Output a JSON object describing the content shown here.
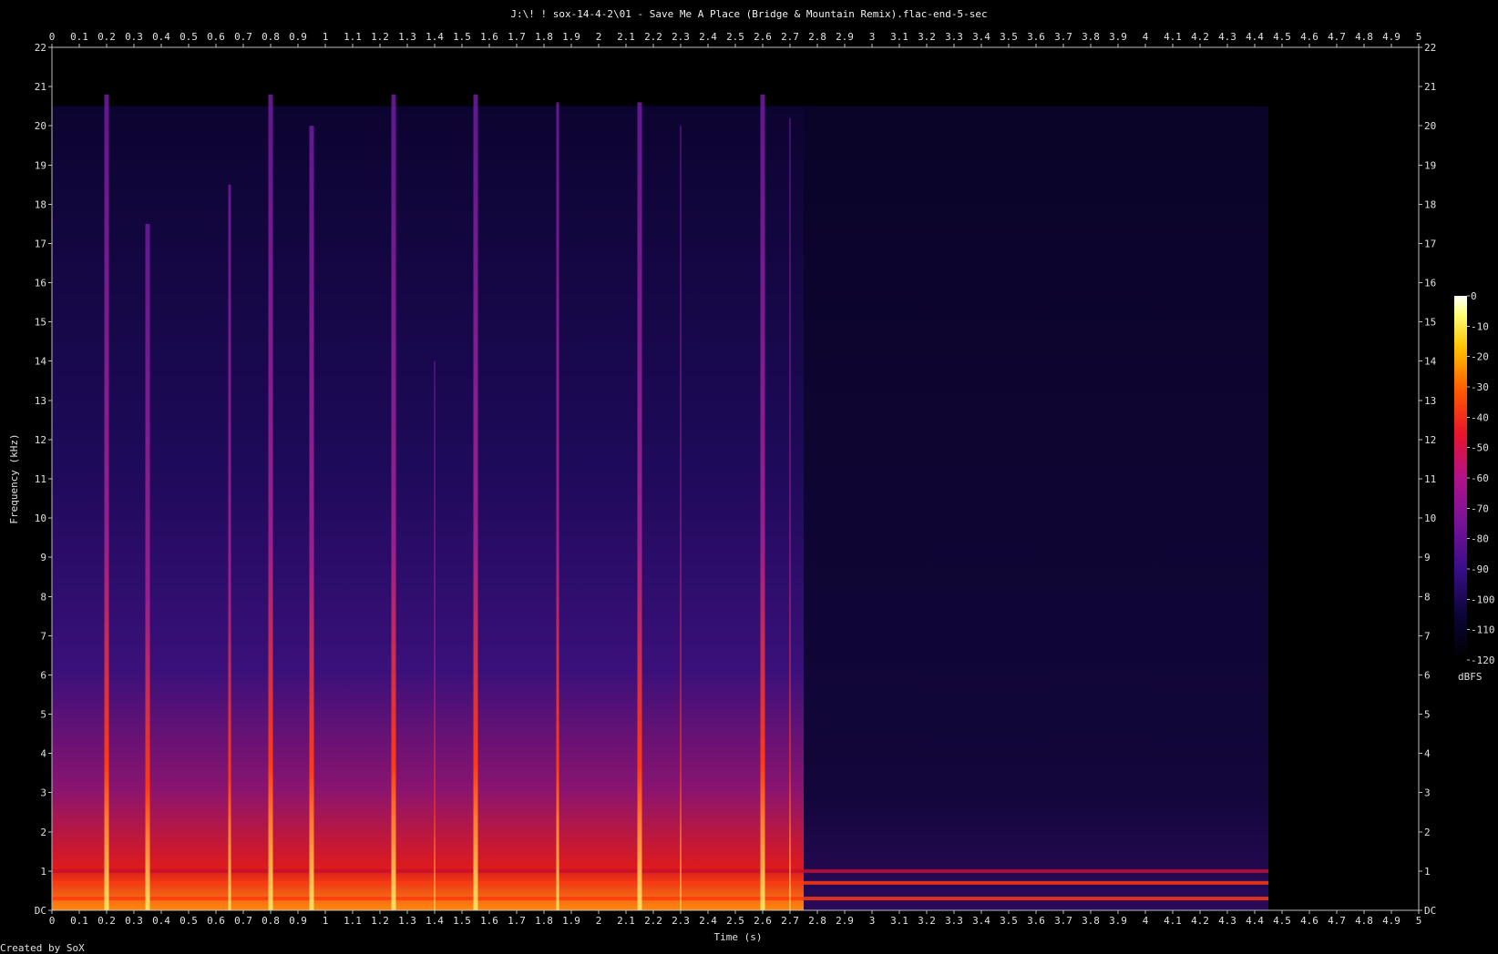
{
  "chart_data": {
    "type": "heatmap",
    "title": "J:\\! ! sox-14-4-2\\01 - Save Me A Place (Bridge & Mountain Remix).flac-end-5-sec",
    "xlabel": "Time (s)",
    "ylabel": "Frequency (kHz)",
    "footer": "Created by SoX",
    "xlim": [
      0,
      5
    ],
    "ylim": [
      0,
      22
    ],
    "x_ticks": [
      "0",
      "0.1",
      "0.2",
      "0.3",
      "0.4",
      "0.5",
      "0.6",
      "0.7",
      "0.8",
      "0.9",
      "1",
      "1.1",
      "1.2",
      "1.3",
      "1.4",
      "1.5",
      "1.6",
      "1.7",
      "1.8",
      "1.9",
      "2",
      "2.1",
      "2.2",
      "2.3",
      "2.4",
      "2.5",
      "2.6",
      "2.7",
      "2.8",
      "2.9",
      "3",
      "3.1",
      "3.2",
      "3.3",
      "3.4",
      "3.5",
      "3.6",
      "3.7",
      "3.8",
      "3.9",
      "4",
      "4.1",
      "4.2",
      "4.3",
      "4.4",
      "4.5",
      "4.6",
      "4.7",
      "4.8",
      "4.9",
      "5"
    ],
    "y_ticks": [
      "DC",
      "1",
      "2",
      "3",
      "4",
      "5",
      "6",
      "7",
      "8",
      "9",
      "10",
      "11",
      "12",
      "13",
      "14",
      "15",
      "16",
      "17",
      "18",
      "19",
      "20",
      "21",
      "22"
    ],
    "colorbar": {
      "label": "dBFS",
      "range": [
        -120,
        0
      ],
      "ticks": [
        "0",
        "-10",
        "-20",
        "-30",
        "-40",
        "-50",
        "-60",
        "-70",
        "-80",
        "-90",
        "-100",
        "-110",
        "-120"
      ]
    },
    "transients": [
      {
        "time": 0.2,
        "top_khz": 20.8,
        "level_db": -8
      },
      {
        "time": 0.35,
        "top_khz": 17.5,
        "level_db": -4
      },
      {
        "time": 0.65,
        "top_khz": 18.5,
        "level_db": -30
      },
      {
        "time": 0.8,
        "top_khz": 20.8,
        "level_db": -6
      },
      {
        "time": 0.95,
        "top_khz": 20.0,
        "level_db": -4
      },
      {
        "time": 1.25,
        "top_khz": 20.8,
        "level_db": -10
      },
      {
        "time": 1.4,
        "top_khz": 14.0,
        "level_db": -50
      },
      {
        "time": 1.55,
        "top_khz": 20.8,
        "level_db": -6
      },
      {
        "time": 1.85,
        "top_khz": 20.6,
        "level_db": -30
      },
      {
        "time": 2.15,
        "top_khz": 20.6,
        "level_db": -6
      },
      {
        "time": 2.3,
        "top_khz": 20.0,
        "level_db": -40
      },
      {
        "time": 2.6,
        "top_khz": 20.8,
        "level_db": -10
      },
      {
        "time": 2.7,
        "top_khz": 20.2,
        "level_db": -40
      }
    ],
    "active_region": {
      "start_s": 0.0,
      "end_s": 2.75,
      "noise_floor_end_s": 4.45,
      "sustained_tones_khz": [
        0.3,
        0.7,
        1.0
      ]
    }
  }
}
